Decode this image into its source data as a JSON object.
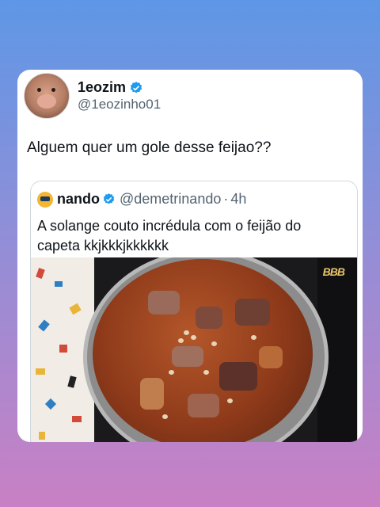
{
  "tweet": {
    "display_name": "1eozim",
    "handle": "@1eozinho01",
    "text": "Alguem quer um gole desse feijao??"
  },
  "quoted_tweet": {
    "display_name": "nando",
    "handle": "@demetrinando",
    "separator": "·",
    "time": "4h",
    "text": "A solange couto incrédula com o feijão do capeta kkjkkkjkkkkkk",
    "media_logo": "BBB"
  },
  "colors": {
    "verified": "#1d9bf0",
    "background_top": "#5e97e6",
    "background_bottom": "#c980c4"
  }
}
